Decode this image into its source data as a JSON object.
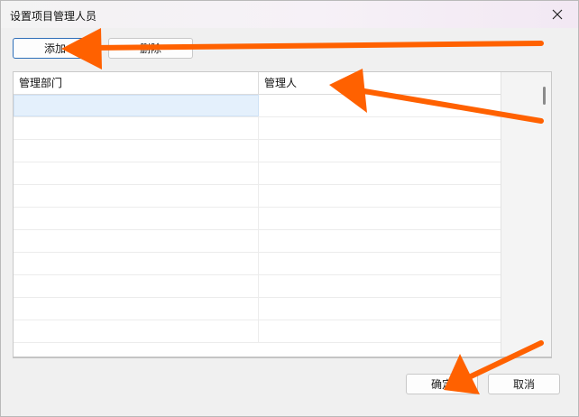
{
  "window": {
    "title": "设置项目管理人员"
  },
  "toolbar": {
    "add_label": "添加",
    "delete_label": "删除"
  },
  "grid": {
    "columns": [
      {
        "label": "管理部门"
      },
      {
        "label": "管理人"
      }
    ],
    "row_count": 11,
    "selected_row": 0,
    "selected_column": 0
  },
  "footer": {
    "ok_label": "确定",
    "cancel_label": "取消"
  },
  "icons": {
    "close": "close-icon"
  },
  "colors": {
    "annotation_arrow": "#ff6100",
    "selection": "#e4f0fc",
    "primary_border": "#2f6fb8"
  }
}
